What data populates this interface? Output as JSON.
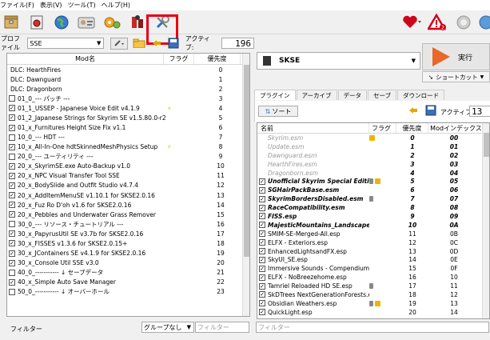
{
  "menu": [
    "ファイル(F)",
    "表示(V)",
    "ツール(T)",
    "ヘルプ(H)"
  ],
  "toolbar": {
    "icons": [
      "archive-icon",
      "settings-icon",
      "globe-icon",
      "profiles-icon",
      "plugins-gear-icon",
      "executables-icon",
      "tools-icon"
    ],
    "right_icons": [
      "heart-icon",
      "warning-icon",
      "update-icon",
      "help-icon"
    ],
    "warning_count": "2"
  },
  "profile": {
    "label": "プロファイル",
    "value": "SSE",
    "active_label": "アクティブ:",
    "active_count": "196"
  },
  "left": {
    "headers": {
      "name": "Mod名",
      "flags": "フラグ",
      "priority": "優先度"
    },
    "rows": [
      {
        "cb": "",
        "name": "DLC: HearthFires",
        "flag": "",
        "pri": "0"
      },
      {
        "cb": "",
        "name": "DLC: Dawnguard",
        "flag": "",
        "pri": "1"
      },
      {
        "cb": "",
        "name": "DLC: Dragonborn",
        "flag": "",
        "pri": "2"
      },
      {
        "cb": "empty",
        "name": "01_0_--- パッチ ---",
        "flag": "",
        "pri": "3"
      },
      {
        "cb": "checked",
        "name": "01_1_USSEP - Japanese Voice Edit v4.1.9",
        "flag": "bolt",
        "pri": "4"
      },
      {
        "cb": "checked",
        "name": "01_2_Japanese Strings for Skyrim SE v1.5.80.0-r2",
        "flag": "",
        "pri": "5"
      },
      {
        "cb": "checked",
        "name": "01_x_Furnitures Height Size Fix v1.1",
        "flag": "",
        "pri": "6"
      },
      {
        "cb": "empty",
        "name": "10_0_--- HDT ---",
        "flag": "",
        "pri": "7"
      },
      {
        "cb": "checked",
        "name": "10_x_All-In-One hdtSkinnedMeshPhysics Setup",
        "flag": "bolt",
        "pri": "8"
      },
      {
        "cb": "empty",
        "name": "20_0_--- ユーティリティ ---",
        "flag": "",
        "pri": "9"
      },
      {
        "cb": "checked",
        "name": "20_x_SkyrimSE.exe Auto-Backup v1.0",
        "flag": "",
        "pri": "10"
      },
      {
        "cb": "checked",
        "name": "20_x_NPC Visual Transfer Tool SSE",
        "flag": "",
        "pri": "11"
      },
      {
        "cb": "checked",
        "name": "20_x_BodySlide and Outfit Studio v4.7.4",
        "flag": "",
        "pri": "12"
      },
      {
        "cb": "checked",
        "name": "20_x_AddItemMenuSE v1.10.1 for SKSE2.0.16",
        "flag": "",
        "pri": "13"
      },
      {
        "cb": "checked",
        "name": "20_x_Fuz Ro D'oh v1.6 for SKSE2.0.16",
        "flag": "",
        "pri": "14"
      },
      {
        "cb": "checked",
        "name": "20_x_Pebbles and Underwater Grass Remover",
        "flag": "",
        "pri": "15"
      },
      {
        "cb": "empty",
        "name": "30_0_--- リソース・チュートリアル ---",
        "flag": "",
        "pri": "16"
      },
      {
        "cb": "checked",
        "name": "30_x_PapyrusUtil SE v3.7b for SKSE2.0.16",
        "flag": "",
        "pri": "17"
      },
      {
        "cb": "checked",
        "name": "30_x_FISSES v1.3.6 for SKSE2.0.15+",
        "flag": "",
        "pri": "18"
      },
      {
        "cb": "checked",
        "name": "30_x_JContainers SE v4.1.9 for SKSE2.0.16",
        "flag": "",
        "pri": "19"
      },
      {
        "cb": "checked",
        "name": "30_x_Console Util SSE v3.0",
        "flag": "",
        "pri": "20"
      },
      {
        "cb": "empty",
        "name": "40_0_----------- ↓ セーブデータ",
        "flag": "",
        "pri": "21"
      },
      {
        "cb": "checked",
        "name": "40_x_Simple Auto Save Manager",
        "flag": "",
        "pri": "22"
      },
      {
        "cb": "empty",
        "name": "50_0_----------- ↓ オーバーホール",
        "flag": "",
        "pri": "23"
      }
    ]
  },
  "left_bottom": {
    "filter_label": "フィルター",
    "group_value": "グループなし",
    "filter_placeholder": "フィルター"
  },
  "right": {
    "exe_name": "SKSE",
    "run_label": "実行",
    "shortcut_label": "ショートカット",
    "tabs": [
      "プラグイン",
      "アーカイブ",
      "データ",
      "セーブ",
      "ダウンロード"
    ],
    "sort_label": "ソート",
    "active_label": "アクティブ:",
    "active_count": "13",
    "headers": {
      "name": "名前",
      "flags": "フラグ",
      "priority": "優先度",
      "index": "Modインデックス"
    },
    "rows": [
      {
        "style": "grey",
        "cb": "",
        "name": "Skyrim.esm",
        "flag": "bsa",
        "pri": "0",
        "idx": "00"
      },
      {
        "style": "grey",
        "cb": "",
        "name": "Update.esm",
        "flag": "",
        "pri": "1",
        "idx": "01"
      },
      {
        "style": "grey",
        "cb": "",
        "name": "Dawnguard.esm",
        "flag": "",
        "pri": "2",
        "idx": "02"
      },
      {
        "style": "grey",
        "cb": "",
        "name": "HearthFires.esm",
        "flag": "",
        "pri": "3",
        "idx": "03"
      },
      {
        "style": "grey",
        "cb": "",
        "name": "Dragonborn.esm",
        "flag": "",
        "pri": "4",
        "idx": "04"
      },
      {
        "style": "bi",
        "cb": "checked",
        "name": "Unofficial Skyrim Special Edition ...",
        "flag": "lockbsa",
        "pri": "5",
        "idx": "05"
      },
      {
        "style": "bi",
        "cb": "checked",
        "name": "SGHairPackBase.esm",
        "flag": "",
        "pri": "6",
        "idx": "06"
      },
      {
        "style": "bi",
        "cb": "checked",
        "name": "SkyrimBordersDisabled.esm",
        "flag": "lock",
        "pri": "7",
        "idx": "07"
      },
      {
        "style": "bi",
        "cb": "checked",
        "name": "RaceCompatibility.esm",
        "flag": "",
        "pri": "8",
        "idx": "08"
      },
      {
        "style": "bi",
        "cb": "checked",
        "name": "FISS.esp",
        "flag": "",
        "pri": "9",
        "idx": "09"
      },
      {
        "style": "bi",
        "cb": "checked",
        "name": "MajesticMountains_Landscape.esm",
        "flag": "",
        "pri": "10",
        "idx": "0A"
      },
      {
        "style": "plain",
        "cb": "checked",
        "name": "SMIM-SE-Merged-All.esp",
        "flag": "",
        "pri": "11",
        "idx": "0B"
      },
      {
        "style": "plain",
        "cb": "checked",
        "name": "ELFX - Exteriors.esp",
        "flag": "",
        "pri": "12",
        "idx": "0C"
      },
      {
        "style": "plain",
        "cb": "checked",
        "name": "EnhancedLightsandFX.esp",
        "flag": "",
        "pri": "13",
        "idx": "0D"
      },
      {
        "style": "plain",
        "cb": "checked",
        "name": "SkyUI_SE.esp",
        "flag": "",
        "pri": "14",
        "idx": "0E"
      },
      {
        "style": "plain",
        "cb": "checked",
        "name": "Immersive Sounds - Compendium...",
        "flag": "",
        "pri": "15",
        "idx": "0F"
      },
      {
        "style": "plain",
        "cb": "checked",
        "name": "ELFX - NoBreezehome.esp",
        "flag": "",
        "pri": "16",
        "idx": "10"
      },
      {
        "style": "plain",
        "cb": "checked",
        "name": "Tamriel Reloaded HD SE.esp",
        "flag": "lock",
        "pri": "17",
        "idx": "11"
      },
      {
        "style": "plain",
        "cb": "checked",
        "name": "SkDTrees NextGenerationForests.e...",
        "flag": "",
        "pri": "18",
        "idx": "12"
      },
      {
        "style": "plain",
        "cb": "checked",
        "name": "Obsidian Weathers.esp",
        "flag": "lockbsa",
        "pri": "19",
        "idx": "13"
      },
      {
        "style": "plain",
        "cb": "checked",
        "name": "QuickLight.esp",
        "flag": "",
        "pri": "20",
        "idx": "14"
      }
    ],
    "filter_placeholder": "フィルター"
  }
}
